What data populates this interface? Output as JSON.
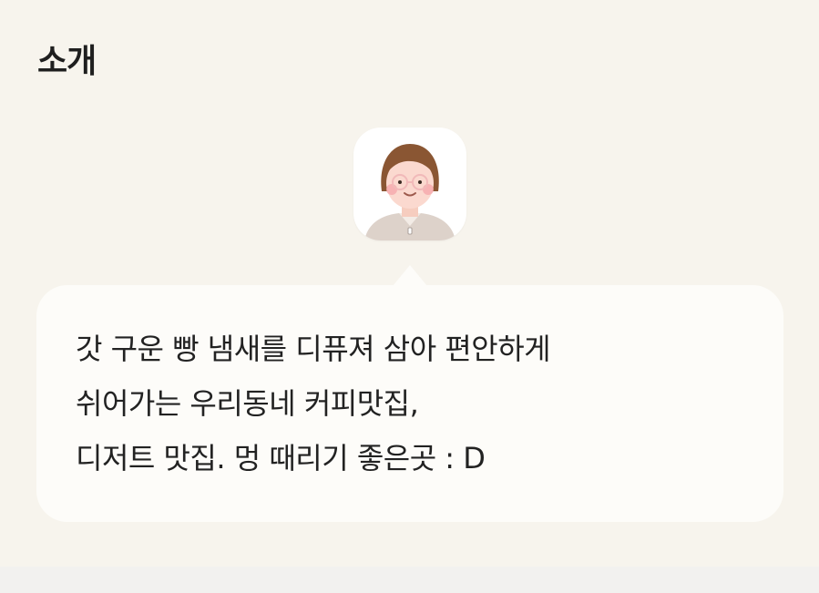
{
  "section": {
    "title": "소개"
  },
  "avatar": {
    "icon": "profile-illustration-icon",
    "colors": {
      "hair": "#8a5633",
      "skin": "#fbd9cf",
      "cheek": "#f6a8ab",
      "shirt": "#ddd2ca"
    }
  },
  "intro": {
    "lines": [
      "갓 구운 빵 냄새를 디퓨져 삼아 편안하게",
      "쉬어가는 우리동네 커피맛집,",
      "디저트 맛집. 멍 때리기 좋은곳 : D"
    ]
  },
  "colors": {
    "section_bg": "#f7f4ed",
    "bubble_bg": "#fdfcf9",
    "page_bg": "#f2f1ef",
    "text": "#222222"
  }
}
